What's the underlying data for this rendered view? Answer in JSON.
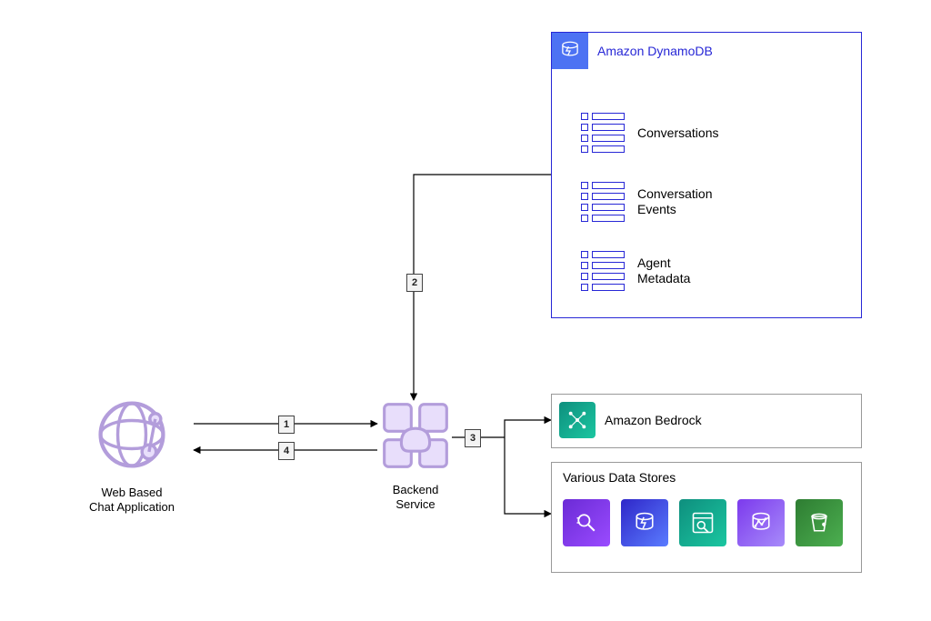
{
  "diagram": {
    "nodes": {
      "web_app": {
        "label": "Web Based\nChat Application"
      },
      "backend": {
        "label": "Backend Service"
      }
    },
    "groups": {
      "dynamodb": {
        "title": "Amazon DynamoDB",
        "tables": [
          {
            "label": "Conversations"
          },
          {
            "label": "Conversation\nEvents"
          },
          {
            "label": "Agent\nMetadata"
          }
        ]
      },
      "bedrock": {
        "title": "Amazon Bedrock"
      },
      "datastores": {
        "title": "Various Data Stores",
        "items": [
          {
            "name": "opensearch-icon",
            "color": "purple"
          },
          {
            "name": "dynamodb-icon",
            "color": "bluegrad"
          },
          {
            "name": "search-service-icon",
            "color": "teal"
          },
          {
            "name": "analytics-db-icon",
            "color": "violet"
          },
          {
            "name": "s3-bucket-icon",
            "color": "green"
          }
        ]
      }
    },
    "edges": [
      {
        "step": "1",
        "from": "web_app",
        "to": "backend"
      },
      {
        "step": "2",
        "from": "backend",
        "to": "dynamodb"
      },
      {
        "step": "3",
        "from": "backend",
        "to": "bedrock_and_datastores"
      },
      {
        "step": "4",
        "from": "backend",
        "to": "web_app"
      }
    ]
  }
}
